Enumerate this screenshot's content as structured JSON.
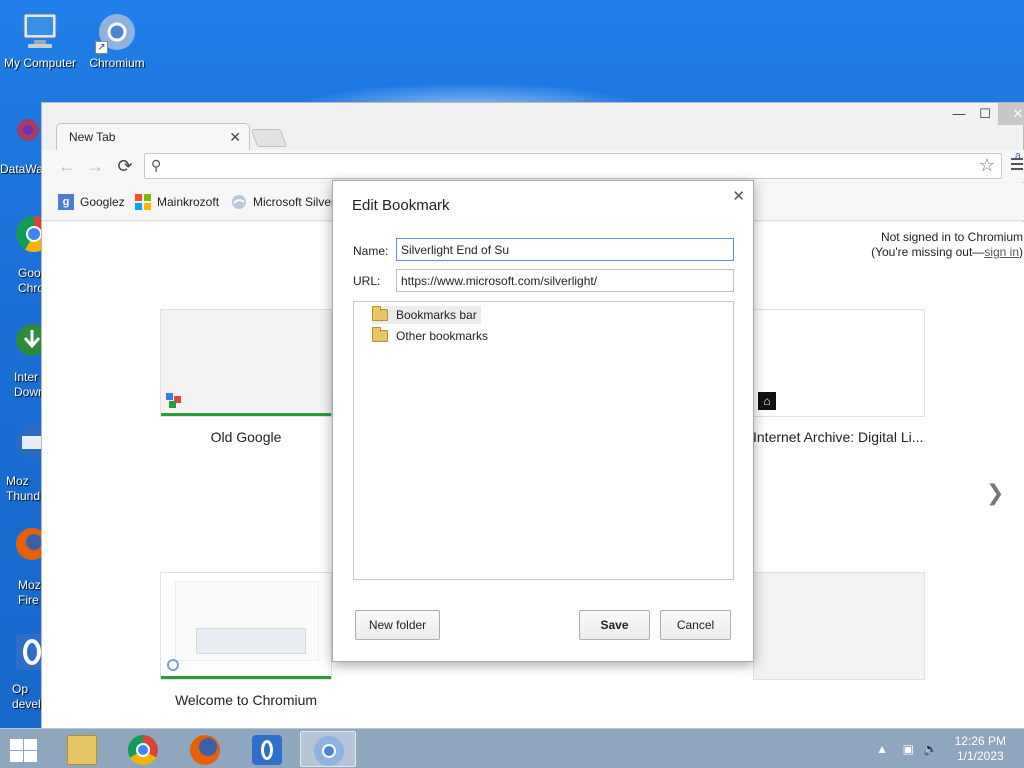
{
  "desktop": {
    "icons": [
      {
        "label": "My Computer"
      },
      {
        "label": "Chromium"
      }
    ],
    "side_labels": [
      "DataWa",
      "Goo\nChro",
      "Inter\nDown",
      "Moz\nThund",
      "Moz\nFire",
      "Op\ndevel"
    ]
  },
  "browser": {
    "tab_title": "New Tab",
    "omnibox_value": "",
    "bookmarks": [
      {
        "label": "Googlez"
      },
      {
        "label": "Mainkrozoft"
      },
      {
        "label": "Microsoft Silver"
      }
    ],
    "signin": {
      "line1": "Not signed in to Chromium",
      "line2_prefix": "(You're missing out—",
      "link": "sign in",
      "line2_suffix": ")"
    },
    "thumbnails": [
      {
        "label": "Old Google"
      },
      {
        "label": "Internet Archive: Digital Li..."
      },
      {
        "label": "Welcome to Chromium"
      }
    ]
  },
  "dialog": {
    "title": "Edit Bookmark",
    "name_label": "Name:",
    "name_value": "Silverlight End of Su",
    "url_label": "URL:",
    "url_value": "https://www.microsoft.com/silverlight/",
    "folders": [
      {
        "label": "Bookmarks bar",
        "selected": true
      },
      {
        "label": "Other bookmarks",
        "selected": false
      }
    ],
    "new_folder": "New folder",
    "save": "Save",
    "cancel": "Cancel"
  },
  "taskbar": {
    "time": "12:26 PM",
    "date": "1/1/2023"
  }
}
